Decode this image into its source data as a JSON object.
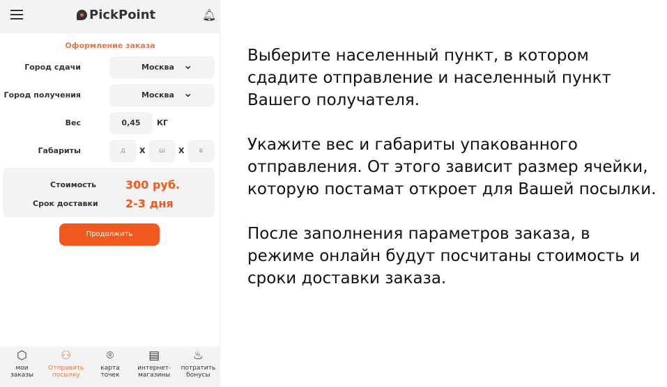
{
  "header": {
    "logo": "PickPoint"
  },
  "form": {
    "title": "Оформление заказа",
    "from_label": "Город сдачи",
    "from_value": "Москва",
    "to_label": "Город получения",
    "to_value": "Москва",
    "weight_label": "Вес",
    "weight_value": "0,45",
    "weight_unit": "КГ",
    "dims_label": "Габариты",
    "dim_l": "д",
    "dim_w": "ш",
    "dim_h": "в",
    "sep": "Х"
  },
  "summary": {
    "cost_label": "Стоимость",
    "cost_value": "300 руб.",
    "term_label": "Срок доставки",
    "term_value": "2-3 дня"
  },
  "continue_label": "Продолжить",
  "nav": [
    {
      "l1": "мои",
      "l2": "заказы"
    },
    {
      "l1": "Отправить",
      "l2": "посылку"
    },
    {
      "l1": "карта",
      "l2": "точек"
    },
    {
      "l1": "интернет-",
      "l2": "магазины"
    },
    {
      "l1": "потратить",
      "l2": "бонусы"
    }
  ],
  "instructions": [
    "Выберите населенный пункт, в котором сдадите отправление и населенный пункт Вашего получателя.",
    "Укажите вес и габариты упакованного отправления. От этого зависит размер ячейки, которую постамат откроет для Вашей посылки.",
    "После заполнения параметров заказа, в режиме онлайн будут посчитаны стоимость и сроки доставки заказа."
  ]
}
